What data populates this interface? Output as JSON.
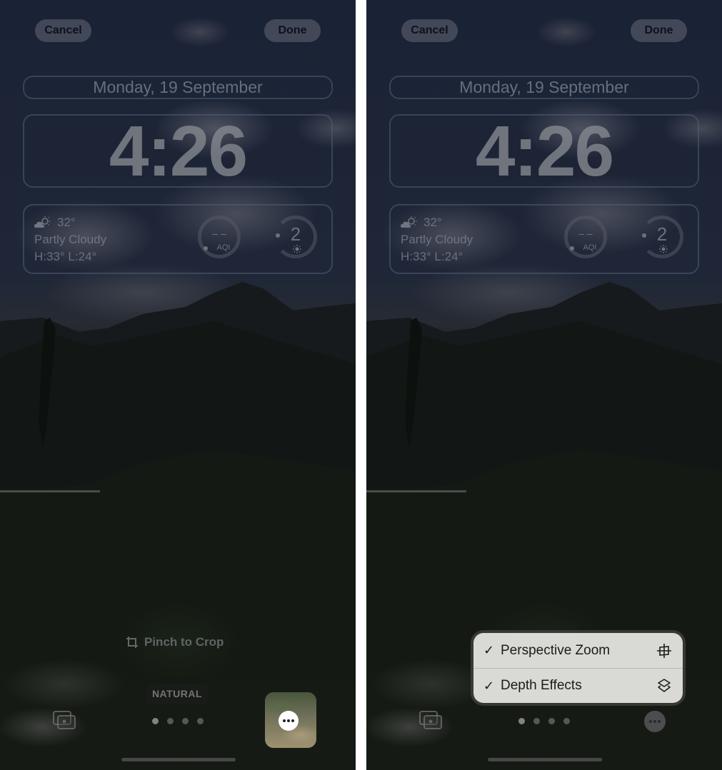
{
  "panels": [
    {
      "id": "left",
      "top_bar": {
        "cancel_label": "Cancel",
        "done_label": "Done"
      },
      "lock_screen": {
        "date": "Monday, 19 September",
        "time": "4:26",
        "weather": {
          "icon": "partly-cloudy-sun-icon",
          "temperature": "32°",
          "condition": "Partly Cloudy",
          "high_low": "H:33° L:24°"
        },
        "aqi_widget": {
          "value": "– –",
          "label": "AQI"
        },
        "uv_widget": {
          "value": "2",
          "icon": "sun-icon"
        }
      },
      "bottom": {
        "hint_icon": "crop-icon",
        "hint": "Pinch to Crop",
        "filter_label": "NATURAL",
        "page_dots": {
          "count": 4,
          "active_index": 0
        },
        "photo_library_icon": "photo-stack-icon",
        "more_button_icon": "ellipsis-icon"
      }
    },
    {
      "id": "right",
      "top_bar": {
        "cancel_label": "Cancel",
        "done_label": "Done"
      },
      "lock_screen": {
        "date": "Monday, 19 September",
        "time": "4:26",
        "weather": {
          "icon": "partly-cloudy-sun-icon",
          "temperature": "32°",
          "condition": "Partly Cloudy",
          "high_low": "H:33° L:24°"
        },
        "aqi_widget": {
          "value": "– –",
          "label": "AQI"
        },
        "uv_widget": {
          "value": "2",
          "icon": "sun-icon"
        }
      },
      "bottom": {
        "page_dots": {
          "count": 4,
          "active_index": 0
        },
        "photo_library_icon": "photo-stack-icon",
        "more_button_icon": "ellipsis-icon"
      },
      "menu": {
        "items": [
          {
            "label": "Perspective Zoom",
            "checked": true,
            "check_glyph": "✓",
            "icon": "perspective-zoom-icon"
          },
          {
            "label": "Depth Effects",
            "checked": true,
            "check_glyph": "✓",
            "icon": "layers-icon"
          }
        ]
      }
    }
  ],
  "colors": {
    "menu_background": "#d9dad5",
    "menu_text": "#1b1b1b",
    "button_text": "#0c1020",
    "separator": "#ffffff"
  }
}
